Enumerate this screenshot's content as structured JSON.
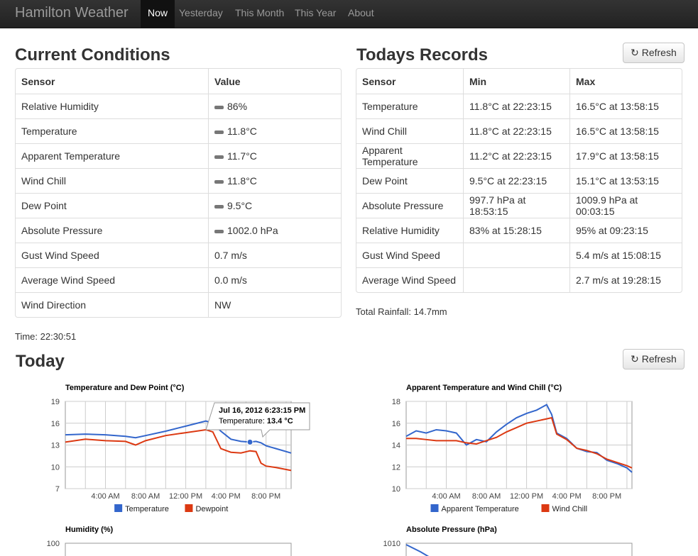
{
  "nav": {
    "brand": "Hamilton Weather",
    "links": [
      "Now",
      "Yesterday",
      "This Month",
      "This Year",
      "About"
    ]
  },
  "current": {
    "title": "Current Conditions",
    "headers": [
      "Sensor",
      "Value"
    ],
    "rows": [
      {
        "sensor": "Relative Humidity",
        "value": "86%",
        "trend": true
      },
      {
        "sensor": "Temperature",
        "value": "11.8°C",
        "trend": true
      },
      {
        "sensor": "Apparent Temperature",
        "value": "11.7°C",
        "trend": true
      },
      {
        "sensor": "Wind Chill",
        "value": "11.8°C",
        "trend": true
      },
      {
        "sensor": "Dew Point",
        "value": "9.5°C",
        "trend": true
      },
      {
        "sensor": "Absolute Pressure",
        "value": "1002.0 hPa",
        "trend": true
      },
      {
        "sensor": "Gust Wind Speed",
        "value": "0.7 m/s",
        "trend": false
      },
      {
        "sensor": "Average Wind Speed",
        "value": "0.0 m/s",
        "trend": false
      },
      {
        "sensor": "Wind Direction",
        "value": "NW",
        "trend": false
      }
    ],
    "time_label": "Time: 22:30:51"
  },
  "records": {
    "title": "Todays Records",
    "refresh_label": "Refresh",
    "headers": [
      "Sensor",
      "Min",
      "Max"
    ],
    "rows": [
      {
        "sensor": "Temperature",
        "min": "11.8°C at 22:23:15",
        "max": "16.5°C at 13:58:15"
      },
      {
        "sensor": "Wind Chill",
        "min": "11.8°C at 22:23:15",
        "max": "16.5°C at 13:58:15"
      },
      {
        "sensor": "Apparent Temperature",
        "min": "11.2°C at 22:23:15",
        "max": "17.9°C at 13:58:15"
      },
      {
        "sensor": "Dew Point",
        "min": "9.5°C at 22:23:15",
        "max": "15.1°C at 13:53:15"
      },
      {
        "sensor": "Absolute Pressure",
        "min": "997.7 hPa at 18:53:15",
        "max": "1009.9 hPa at 00:03:15"
      },
      {
        "sensor": "Relative Humidity",
        "min": "83% at 15:28:15",
        "max": "95% at 09:23:15"
      },
      {
        "sensor": "Gust Wind Speed",
        "min": "",
        "max": "5.4 m/s at 15:08:15"
      },
      {
        "sensor": "Average Wind Speed",
        "min": "",
        "max": "2.7 m/s at 19:28:15"
      }
    ],
    "rainfall_label": "Total Rainfall: 14.7mm"
  },
  "today": {
    "title": "Today",
    "refresh_label": "Refresh"
  },
  "colors": {
    "blue": "#3366cc",
    "red": "#dc3912"
  },
  "chart_data": [
    {
      "type": "line",
      "title": "Temperature and Dew Point (°C)",
      "ylim": [
        7,
        19
      ],
      "yticks": [
        7,
        10,
        13,
        16,
        19
      ],
      "xticks": [
        "4:00 AM",
        "8:00 AM",
        "12:00 PM",
        "4:00 PM",
        "8:00 PM"
      ],
      "x_hours": [
        0,
        2,
        4,
        6,
        7,
        8,
        10,
        12,
        14,
        14.7,
        15.5,
        16.5,
        17.5,
        18.4,
        19,
        19.5,
        20,
        21,
        22.5
      ],
      "series": [
        {
          "name": "Temperature",
          "color": "#3366cc",
          "values": [
            14.4,
            14.5,
            14.4,
            14.2,
            14.0,
            14.3,
            14.9,
            15.6,
            16.3,
            16.0,
            14.9,
            13.8,
            13.5,
            13.4,
            13.5,
            13.3,
            12.9,
            12.5,
            11.9
          ]
        },
        {
          "name": "Dewpoint",
          "color": "#dc3912",
          "values": [
            13.4,
            13.8,
            13.6,
            13.5,
            13.0,
            13.6,
            14.3,
            14.7,
            15.1,
            14.8,
            12.5,
            12.0,
            11.9,
            12.2,
            12.1,
            10.5,
            10.1,
            9.9,
            9.5
          ]
        }
      ],
      "tooltip": {
        "line1": "Jul 16, 2012 6:23:15 PM",
        "label": "Temperature:",
        "value": "13.4 °C",
        "x_hour": 18.4,
        "y": 13.4
      }
    },
    {
      "type": "line",
      "title": "Apparent Temperature and Wind Chill (°C)",
      "ylim": [
        10,
        18
      ],
      "yticks": [
        10,
        12,
        14,
        16,
        18
      ],
      "xticks": [
        "4:00 AM",
        "8:00 AM",
        "12:00 PM",
        "4:00 PM",
        "8:00 PM"
      ],
      "x_hours": [
        0,
        1,
        2,
        3,
        4,
        5,
        6,
        7,
        8,
        9,
        10,
        11,
        12,
        13,
        14,
        14.5,
        15,
        16,
        17,
        18,
        19,
        20,
        21,
        22,
        22.5
      ],
      "series": [
        {
          "name": "Apparent Temperature",
          "color": "#3366cc",
          "values": [
            14.8,
            15.3,
            15.1,
            15.4,
            15.3,
            15.1,
            14.0,
            14.5,
            14.3,
            15.2,
            15.9,
            16.5,
            16.9,
            17.2,
            17.7,
            16.8,
            15.1,
            14.6,
            13.7,
            13.4,
            13.3,
            12.6,
            12.3,
            11.9,
            11.5
          ]
        },
        {
          "name": "Wind Chill",
          "color": "#dc3912",
          "values": [
            14.6,
            14.6,
            14.5,
            14.4,
            14.4,
            14.4,
            14.2,
            14.1,
            14.4,
            14.7,
            15.2,
            15.6,
            16.0,
            16.2,
            16.4,
            16.5,
            15.0,
            14.5,
            13.7,
            13.5,
            13.2,
            12.7,
            12.4,
            12.1,
            11.9
          ]
        }
      ]
    },
    {
      "type": "line",
      "title": "Humidity (%)",
      "yticks": [
        100
      ],
      "series": []
    },
    {
      "type": "line",
      "title": "Absolute Pressure (hPa)",
      "yticks": [
        1010
      ],
      "series": []
    }
  ]
}
